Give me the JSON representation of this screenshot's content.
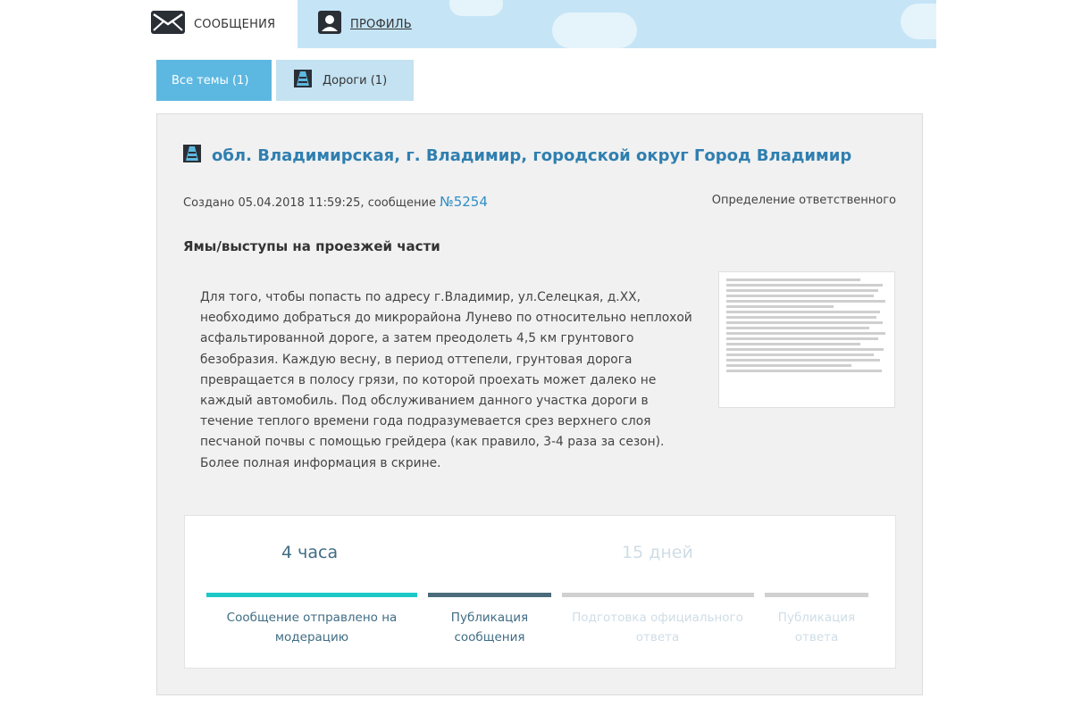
{
  "header": {
    "messages_tab": "СООБЩЕНИЯ",
    "profile_tab": "ПРОФИЛЬ"
  },
  "categories": {
    "all": "Все темы (1)",
    "roads": "Дороги (1)"
  },
  "message": {
    "title": "обл. Владимирская, г. Владимир, городской округ Город Владимир",
    "created_prefix": "Создано 05.04.2018 11:59:25, сообщение ",
    "number": "№5254",
    "status": "Определение ответственного",
    "subject": "Ямы/выступы на проезжей части",
    "description": "Для того, чтобы попасть по адресу г.Владимир, ул.Селецкая, д.ХХ, необходимо добраться до микрорайона Лунево по относительно неплохой асфальтированной дороге, а затем преодолеть 4,5 км грунтового безобразия. Каждую весну, в период оттепели, грунтовая дорога превращается в полосу грязи, по которой проехать может далеко не каждый автомобиль. Под обслуживанием данного участка дороги в течение теплого времени года подразумевается срез верхнего слоя песчаной почвы с помощью грейдера (как правило, 3-4 раза за сезон). Более полная информация в скрине."
  },
  "progress": {
    "time_active": "4 часа",
    "time_future": "15 дней",
    "steps": [
      {
        "label": "Сообщение отправлено на модерацию",
        "state": "done"
      },
      {
        "label": "Публикация сообщения",
        "state": "current"
      },
      {
        "label": "Подготовка официального ответа",
        "state": "pending"
      },
      {
        "label": "Публикация ответа",
        "state": "pending"
      }
    ]
  },
  "colors": {
    "accent": "#2f7fb0",
    "tab_active": "#5db8e1",
    "tab_inactive": "#c4e2f2",
    "bar_done": "#1ec8c8",
    "bar_current": "#4a6b7a",
    "bar_pending": "#d0d0d0",
    "text_pending": "#cfdde6"
  },
  "icons": {
    "messages": "envelope-icon",
    "profile": "user-icon",
    "roads": "road-icon"
  }
}
